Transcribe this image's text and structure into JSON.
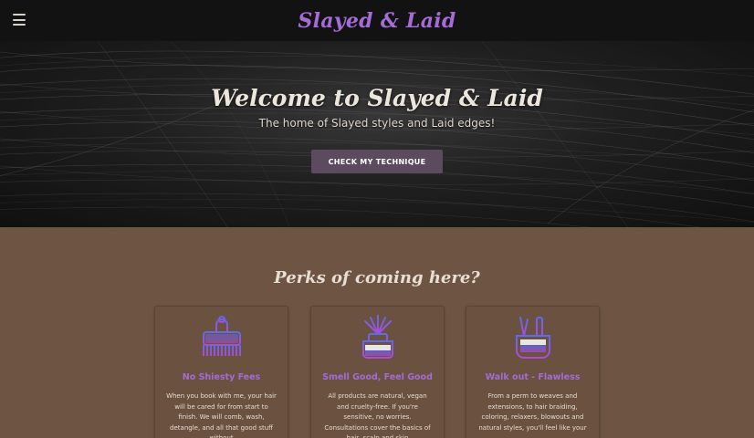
{
  "navbar": {
    "brand": "Slayed & Laid"
  },
  "hero": {
    "title": "Welcome to Slayed & Laid",
    "subtitle": "The home of Slayed styles and Laid edges!",
    "button_label": "CHECK MY TECHNIQUE"
  },
  "perks": {
    "title": "Perks of coming here?",
    "cards": [
      {
        "title": "No Shiesty Fees",
        "text": "When you book with me, your hair will be cared for from start to finish. We will comb, wash, detangle, and all that good stuff without",
        "icon": "comb-icon"
      },
      {
        "title": "Smell Good, Feel Good",
        "text": "All products are natural, vegan and cruelty-free. If you're sensitive, no worries. Consultations cover the basics of hair, scalp and skin",
        "icon": "diffuser-icon"
      },
      {
        "title": "Walk out - Flawless",
        "text": "From a perm to weaves and extensions, to hair braiding, coloring, relaxers, blowouts and natural styles, you'll feel like your",
        "icon": "hair-tools-icon"
      }
    ]
  },
  "colors": {
    "accent": "#a56bd6",
    "navbar": "#121212",
    "perks_background": "#6e5543",
    "button": "#5c4a5e"
  }
}
